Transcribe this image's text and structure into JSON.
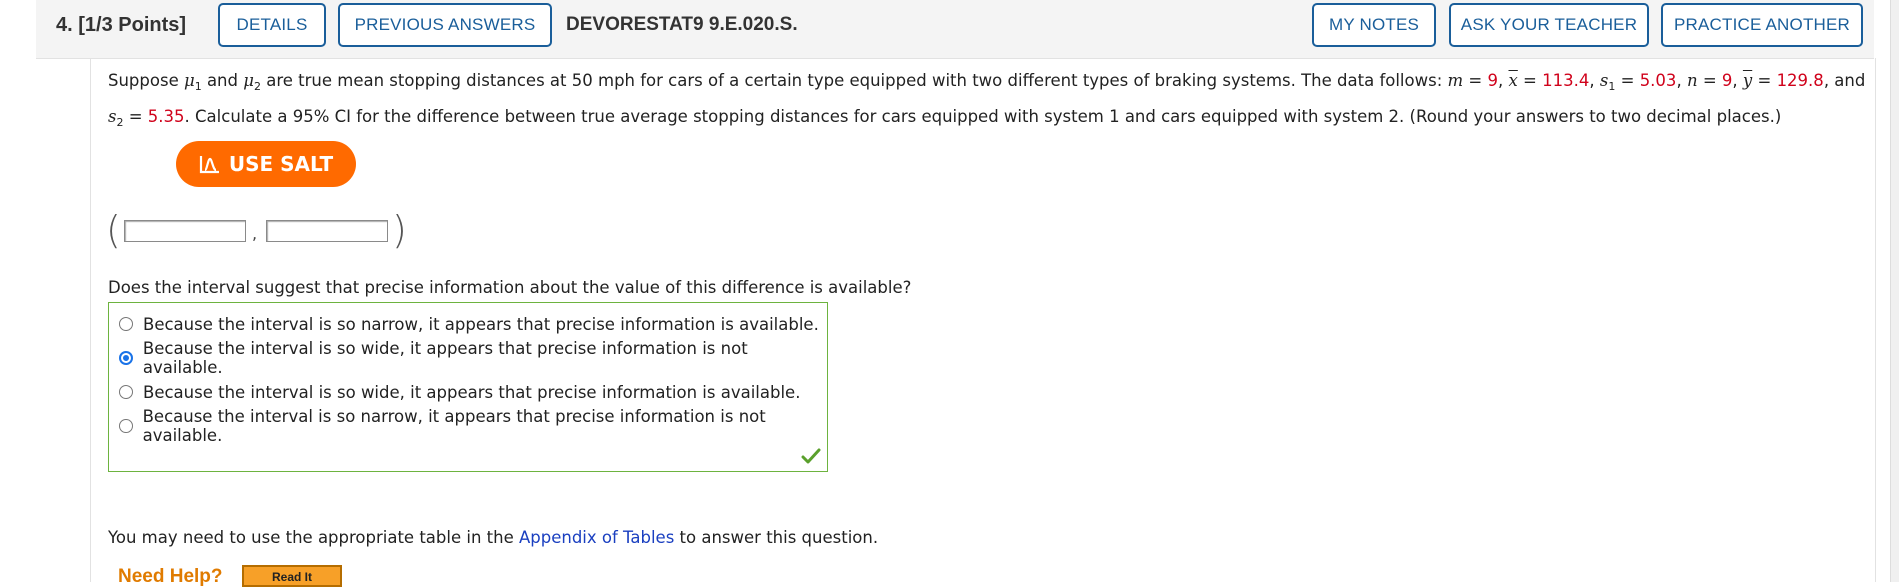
{
  "header": {
    "question_number": "4.",
    "points": "[1/3 Points]",
    "details_label": "DETAILS",
    "previous_answers_label": "PREVIOUS ANSWERS",
    "question_code": "DEVORESTAT9 9.E.020.S.",
    "my_notes_label": "MY NOTES",
    "ask_teacher_label": "ASK YOUR TEACHER",
    "practice_another_label": "PRACTICE ANOTHER"
  },
  "prompt": {
    "t1": "Suppose ",
    "mu": "μ",
    "sub1": "1",
    "t2": " and ",
    "sub2": "2",
    "t3": " are true mean stopping distances at 50 mph for cars of a certain type equipped with two different types of braking systems. The data follows: ",
    "m_sym": "m",
    "eq": " = ",
    "m_val": "9",
    "x_sym": "x",
    "x_val": "113.4",
    "s_sym": "s",
    "s1_val": "5.03",
    "n_sym": "n",
    "n_val": "9",
    "y_sym": "y",
    "y_val": "129.8",
    "and": ", and",
    "s2_val": "5.35",
    "t4": ". Calculate a 95% CI for the difference between true average stopping distances for cars equipped with system 1 and cars equipped with system 2. (Round your answers to two decimal places.)",
    "comma_sep": ", "
  },
  "salt": {
    "label": "USE SALT",
    "icon": "salt-chart-icon"
  },
  "interval": {
    "open": "(",
    "close": ")",
    "comma": ",",
    "lower_value": "",
    "upper_value": ""
  },
  "question2": {
    "text": "Does the interval suggest that precise information about the value of this difference is available?",
    "options": [
      "Because the interval is so narrow, it appears that precise information is available.",
      "Because the interval is so wide, it appears that precise information is not available.",
      "Because the interval is so wide, it appears that precise information is available.",
      "Because the interval is so narrow, it appears that precise information is not available."
    ],
    "selected_index": 1,
    "status_icon": "checkmark-icon"
  },
  "footer": {
    "note_before": "You may need to use the appropriate table in the ",
    "link": "Appendix of Tables",
    "note_after": " to answer this question.",
    "need_help": "Need Help?",
    "read_it": "Read It"
  },
  "colors": {
    "accent": "#1a5e9a",
    "value_red": "#d0021b",
    "salt_orange": "#ff6a00",
    "correct_green": "#6db33f"
  }
}
